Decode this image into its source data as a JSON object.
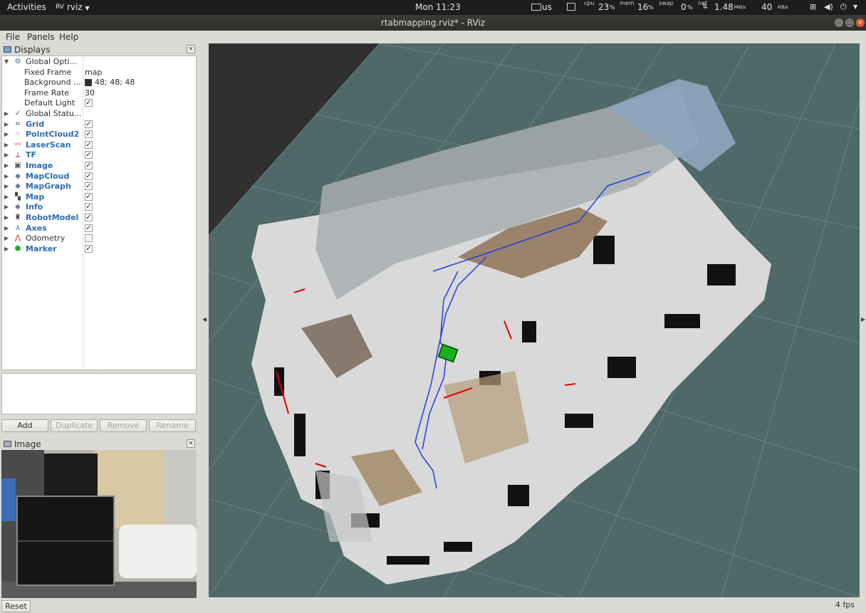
{
  "topbar": {
    "activities": "Activities",
    "app": "rviz",
    "clock": "Mon 11:23",
    "keyboard": "us",
    "cpu_label": "cpu",
    "cpu_value": "23",
    "mem_label": "mem",
    "mem_value": "16",
    "swap_label": "swap",
    "swap_value": "0",
    "net_label": "net",
    "net_down": "1.48",
    "net_down_unit": "MiB/s",
    "net_up": "40",
    "net_up_unit": "KiB/s",
    "percent": "%",
    "icons": [
      "keyboard-icon",
      "monitor-icon",
      "network-icon",
      "volume-icon",
      "power-icon"
    ]
  },
  "window": {
    "title": "rtabmapping.rviz* - RViz"
  },
  "menu": {
    "file": "File",
    "panels": "Panels",
    "help": "Help"
  },
  "displays_panel": {
    "title": "Displays",
    "global_options": {
      "label": "Global Opti...",
      "fixed_frame_label": "Fixed Frame",
      "fixed_frame_value": "map",
      "background_label": "Background ...",
      "background_value": "48; 48; 48",
      "background_color": "#303030",
      "frame_rate_label": "Frame Rate",
      "frame_rate_value": "30",
      "default_light_label": "Default Light",
      "default_light_checked": true
    },
    "global_status_label": "Global Statu...",
    "items": [
      {
        "label": "Grid",
        "icon": "grid-icon",
        "checked": true
      },
      {
        "label": "PointCloud2",
        "icon": "pointcloud-icon",
        "checked": true
      },
      {
        "label": "LaserScan",
        "icon": "laserscan-icon",
        "checked": true
      },
      {
        "label": "TF",
        "icon": "tf-icon",
        "checked": true
      },
      {
        "label": "Image",
        "icon": "image-icon",
        "checked": true
      },
      {
        "label": "MapCloud",
        "icon": "mapcloud-icon",
        "checked": true
      },
      {
        "label": "MapGraph",
        "icon": "mapgraph-icon",
        "checked": true
      },
      {
        "label": "Map",
        "icon": "map-icon",
        "checked": true
      },
      {
        "label": "Info",
        "icon": "info-icon",
        "checked": true
      },
      {
        "label": "RobotModel",
        "icon": "robotmodel-icon",
        "checked": true
      },
      {
        "label": "Axes",
        "icon": "axes-icon",
        "checked": true
      },
      {
        "label": "Odometry",
        "icon": "odometry-icon",
        "checked": false
      },
      {
        "label": "Marker",
        "icon": "marker-icon",
        "checked": true
      }
    ],
    "buttons": {
      "add": "Add",
      "duplicate": "Duplicate",
      "remove": "Remove",
      "rename": "Rename"
    }
  },
  "image_panel": {
    "title": "Image"
  },
  "statusbar": {
    "reset": "Reset",
    "fps": "4 fps"
  },
  "colors": {
    "topbar": "#1d1d1d",
    "ubuntu_close": "#e05a2c",
    "link_blue": "#2b6cb3",
    "grid_floor": "#4f6868",
    "map_free": "#d9d9d9",
    "path_blue": "#1e3fe0",
    "laser_red": "#e00000"
  }
}
